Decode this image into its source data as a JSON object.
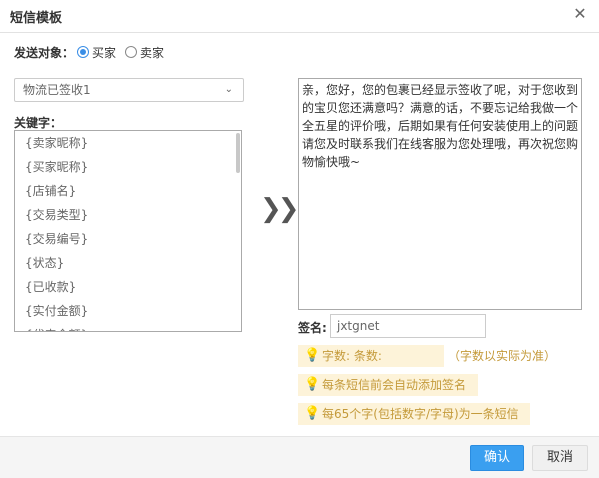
{
  "dialog": {
    "title": "短信模板",
    "close_icon": "close-icon"
  },
  "send_target": {
    "label": "发送对象：",
    "options": [
      {
        "label": "买家",
        "checked": true
      },
      {
        "label": "卖家",
        "checked": false
      }
    ]
  },
  "template_select": {
    "value": "物流已签收1"
  },
  "keywords": {
    "label": "关键字：",
    "items": [
      "{卖家昵称}",
      "{买家昵称}",
      "{店铺名}",
      "{交易类型}",
      "{交易编号}",
      "{状态}",
      "{已收款}",
      "{实付金额}",
      "{代表金额}"
    ]
  },
  "message": {
    "text": "亲，您好，您的包裹已经显示签收了呢，对于您收到的宝贝您还满意吗？满意的话，不要忘记给我做一个全五星的评价哦，后期如果有任何安装使用上的问题请您及时联系我们在线客服为您处理哦，再次祝您购物愉快哦~"
  },
  "signature": {
    "label": "签名:",
    "value": "jxtgnet"
  },
  "tips": {
    "count": "字数: 条数:",
    "count_note": "（字数以实际为准）",
    "auto_sign": "每条短信前会自动添加签名",
    "per_sms": "每65个字(包括数字/字母)为一条短信"
  },
  "footer": {
    "ok_label": "确认",
    "cancel_label": "取消"
  },
  "colors": {
    "primary": "#3a9ff0",
    "tip_bg": "#fdf3d9",
    "tip_text": "#c49a3a"
  }
}
